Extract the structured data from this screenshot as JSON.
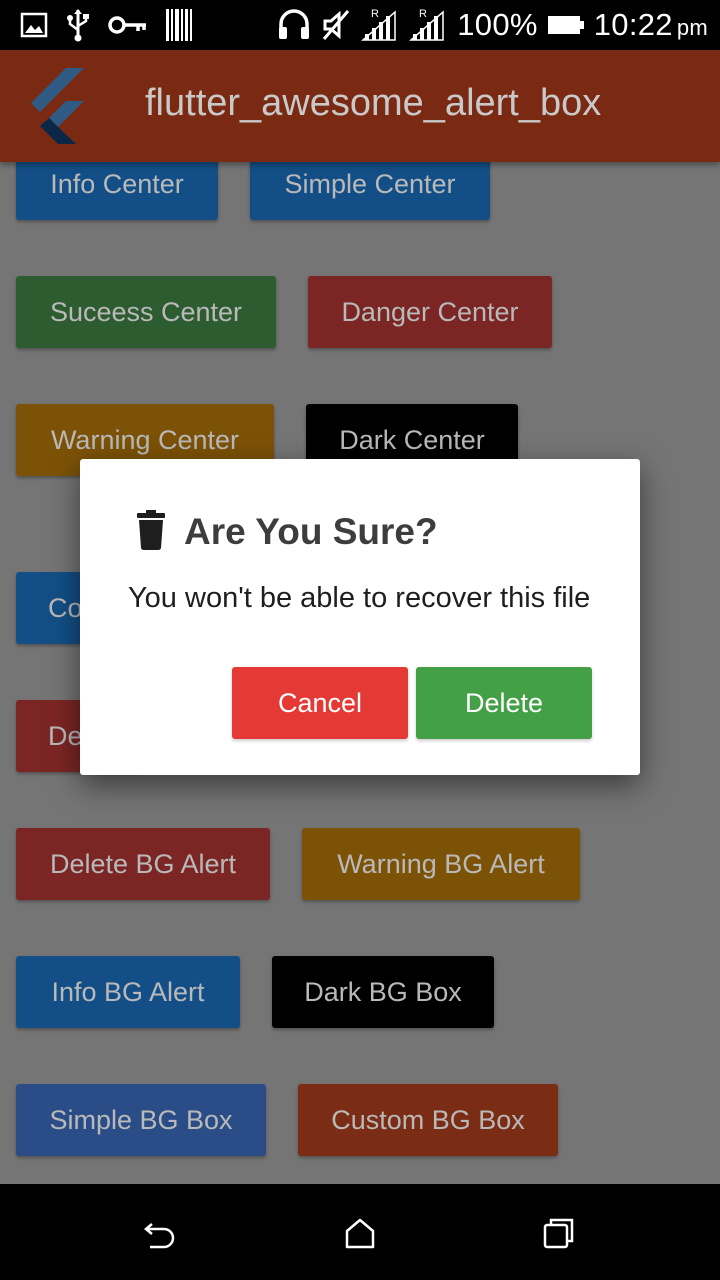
{
  "status_bar": {
    "battery_percent": "100%",
    "time": "10:22",
    "time_suffix": "pm",
    "icons": [
      "gallery-icon",
      "usb-icon",
      "key-icon",
      "barcode-icon",
      "headset-icon",
      "mute-icon",
      "signal-r-icon",
      "signal-r-icon",
      "battery-icon"
    ],
    "signal_badge": "R"
  },
  "app_bar": {
    "title": "flutter_awesome_alert_box",
    "logo_icon": "flutter-logo-icon",
    "color": "#7a2a12"
  },
  "buttons": [
    {
      "label": "Info Center",
      "color": "#134f86"
    },
    {
      "label": "Simple Center",
      "color": "#134f86"
    },
    {
      "label": "Suceess Center",
      "color": "#2d5c30"
    },
    {
      "label": "Danger Center",
      "color": "#7b2624"
    },
    {
      "label": "Warning Center",
      "color": "#7c5206"
    },
    {
      "label": "Dark Center",
      "color": "#000000"
    },
    {
      "label": "Co",
      "color": "#134f86"
    },
    {
      "label": "De",
      "color": "#7b2624"
    },
    {
      "label": "Delete BG Alert",
      "color": "#7b2624"
    },
    {
      "label": "Warning BG Alert",
      "color": "#7c5206"
    },
    {
      "label": "Info BG Alert",
      "color": "#134f86"
    },
    {
      "label": "Dark BG Box",
      "color": "#000000"
    },
    {
      "label": "Simple BG Box",
      "color": "#2a4d88"
    },
    {
      "label": "Custom BG Box",
      "color": "#7a2d14"
    }
  ],
  "dialog": {
    "icon": "trash-icon",
    "title": "Are You Sure?",
    "message": "You won't be able to recover this file",
    "cancel_label": "Cancel",
    "delete_label": "Delete",
    "cancel_color": "#e53935",
    "delete_color": "#43a047"
  },
  "nav_bar": {
    "icons": [
      "back-icon",
      "home-icon",
      "recents-icon"
    ]
  }
}
